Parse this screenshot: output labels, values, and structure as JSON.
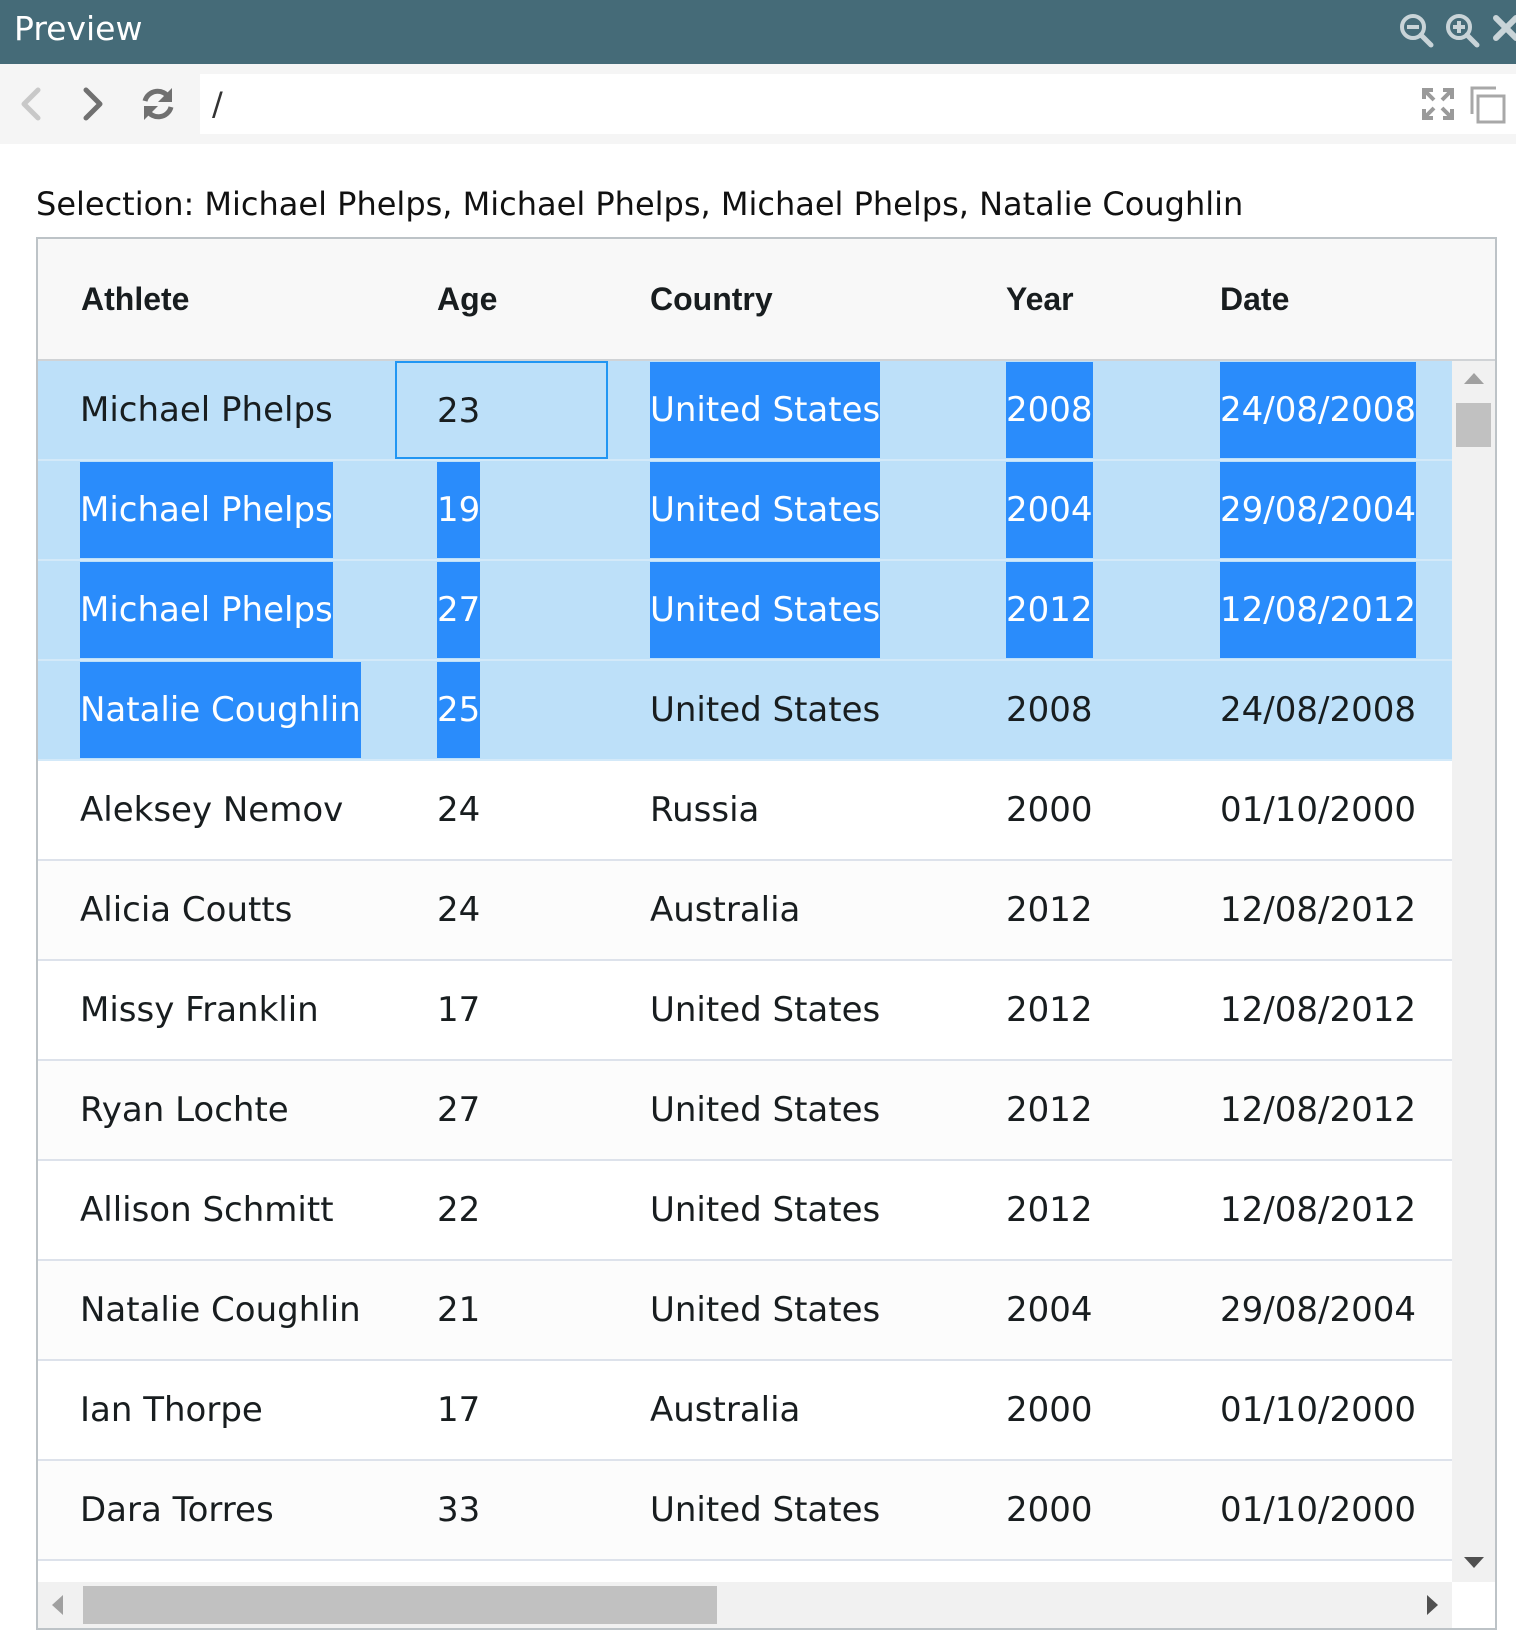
{
  "window": {
    "title": "Preview",
    "icons": [
      "zoom-out-icon",
      "zoom-in-icon",
      "close-icon"
    ]
  },
  "browser": {
    "address": "/",
    "icons": [
      "back-arrow-icon",
      "forward-arrow-icon",
      "refresh-icon",
      "expand-icon",
      "popout-icon"
    ]
  },
  "selection_text": "Selection: Michael Phelps, Michael Phelps, Michael Phelps, Natalie Coughlin",
  "grid": {
    "columns": [
      "Athlete",
      "Age",
      "Country",
      "Year",
      "Date"
    ],
    "rows": [
      {
        "athlete": "Michael Phelps",
        "age": "23",
        "country": "United States",
        "year": "2008",
        "date": "24/08/2008",
        "selected": true,
        "highlight": [
          "country",
          "year",
          "date"
        ],
        "focus": "age"
      },
      {
        "athlete": "Michael Phelps",
        "age": "19",
        "country": "United States",
        "year": "2004",
        "date": "29/08/2004",
        "selected": true,
        "highlight": [
          "athlete",
          "age",
          "country",
          "year",
          "date"
        ]
      },
      {
        "athlete": "Michael Phelps",
        "age": "27",
        "country": "United States",
        "year": "2012",
        "date": "12/08/2012",
        "selected": true,
        "highlight": [
          "athlete",
          "age",
          "country",
          "year",
          "date"
        ]
      },
      {
        "athlete": "Natalie Coughlin",
        "age": "25",
        "country": "United States",
        "year": "2008",
        "date": "24/08/2008",
        "selected": true,
        "highlight": [
          "athlete",
          "age"
        ]
      },
      {
        "athlete": "Aleksey Nemov",
        "age": "24",
        "country": "Russia",
        "year": "2000",
        "date": "01/10/2000",
        "selected": false,
        "highlight": []
      },
      {
        "athlete": "Alicia Coutts",
        "age": "24",
        "country": "Australia",
        "year": "2012",
        "date": "12/08/2012",
        "selected": false,
        "highlight": []
      },
      {
        "athlete": "Missy Franklin",
        "age": "17",
        "country": "United States",
        "year": "2012",
        "date": "12/08/2012",
        "selected": false,
        "highlight": []
      },
      {
        "athlete": "Ryan Lochte",
        "age": "27",
        "country": "United States",
        "year": "2012",
        "date": "12/08/2012",
        "selected": false,
        "highlight": []
      },
      {
        "athlete": "Allison Schmitt",
        "age": "22",
        "country": "United States",
        "year": "2012",
        "date": "12/08/2012",
        "selected": false,
        "highlight": []
      },
      {
        "athlete": "Natalie Coughlin",
        "age": "21",
        "country": "United States",
        "year": "2004",
        "date": "29/08/2004",
        "selected": false,
        "highlight": []
      },
      {
        "athlete": "Ian Thorpe",
        "age": "17",
        "country": "Australia",
        "year": "2000",
        "date": "01/10/2000",
        "selected": false,
        "highlight": []
      },
      {
        "athlete": "Dara Torres",
        "age": "33",
        "country": "United States",
        "year": "2000",
        "date": "01/10/2000",
        "selected": false,
        "highlight": []
      }
    ]
  },
  "colors": {
    "titlebar": "#456b78",
    "selected_row": "#bde0f9",
    "range_highlight": "#2a8cfb",
    "focus_border": "#2196f3"
  }
}
